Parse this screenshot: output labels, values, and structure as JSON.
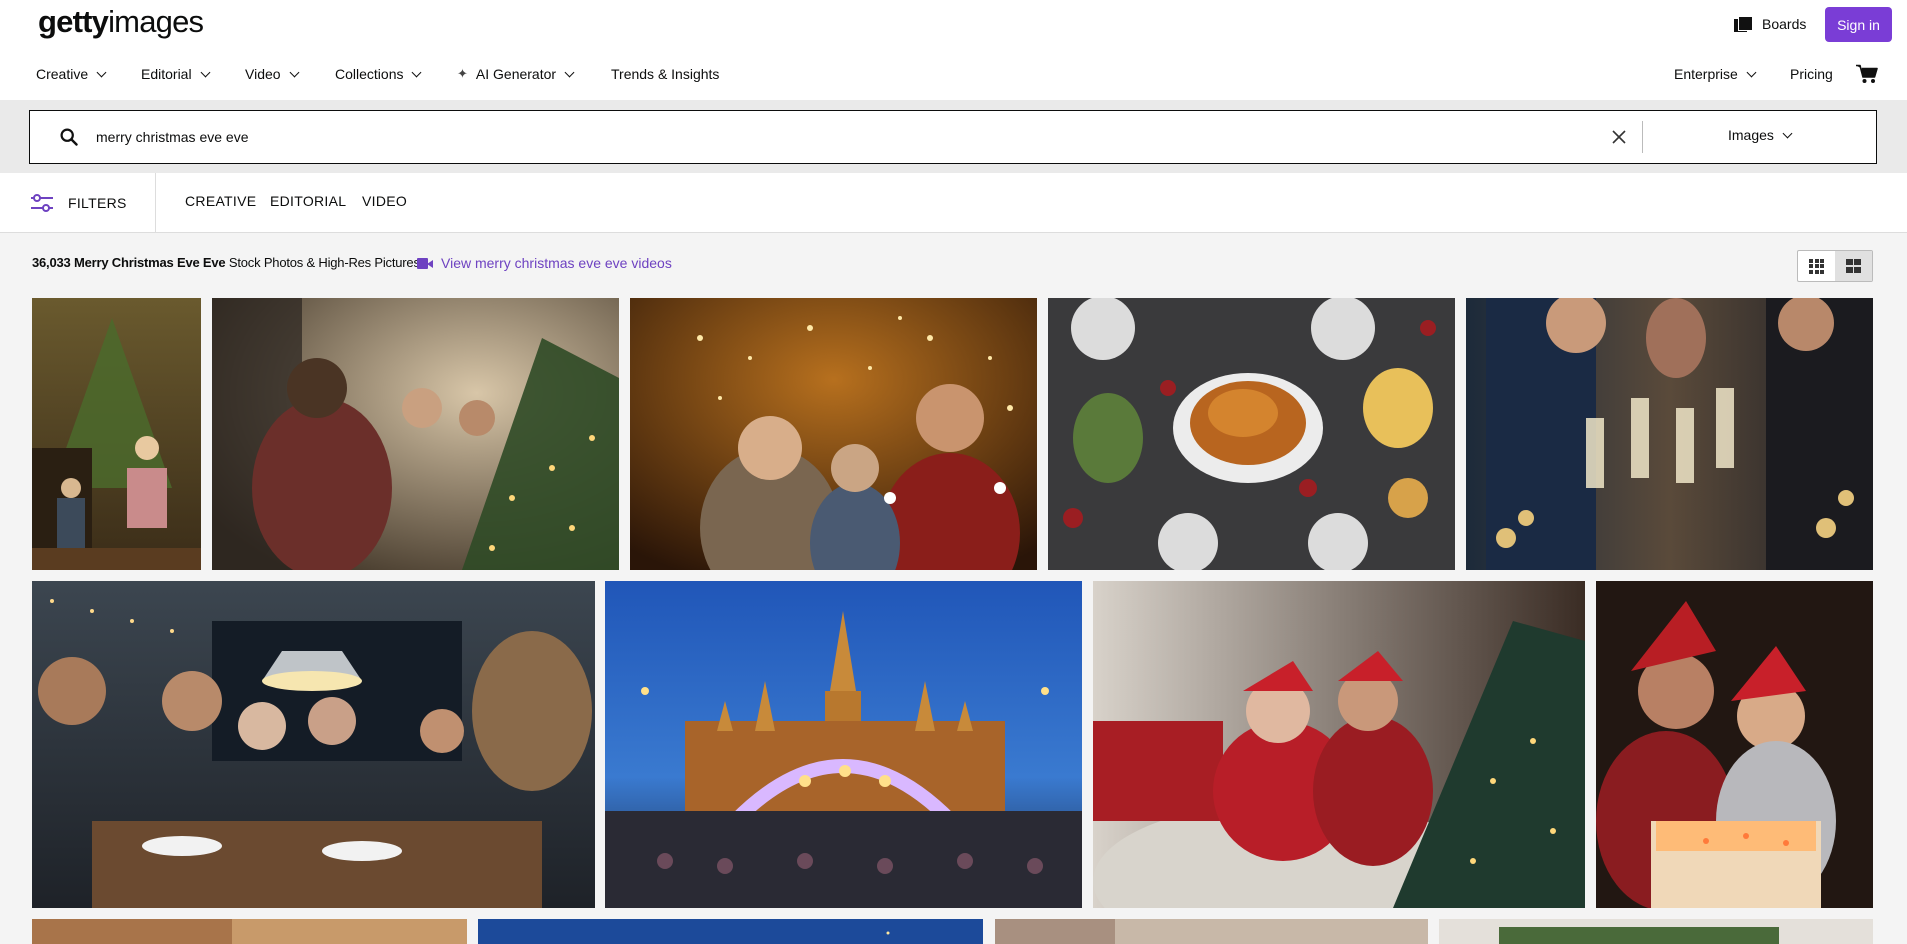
{
  "header": {
    "logo_bold": "getty",
    "logo_light": "images",
    "boards_label": "Boards",
    "signin_label": "Sign in",
    "accent_color": "#7a3dd6"
  },
  "nav": {
    "items": [
      {
        "label": "Creative"
      },
      {
        "label": "Editorial"
      },
      {
        "label": "Video"
      },
      {
        "label": "Collections"
      },
      {
        "label": "AI Generator"
      },
      {
        "label": "Trends & Insights"
      }
    ],
    "enterprise_label": "Enterprise",
    "pricing_label": "Pricing",
    "cart_icon": "cart-icon"
  },
  "search": {
    "query": "merry christmas eve eve",
    "media_type": "Images",
    "search_icon": "search-icon",
    "clear_icon": "close-icon"
  },
  "filters": {
    "button_label": "FILTERS",
    "tabs": [
      {
        "label": "CREATIVE"
      },
      {
        "label": "EDITORIAL"
      },
      {
        "label": "VIDEO"
      }
    ]
  },
  "results": {
    "count_bold": "36,033 Merry Christmas Eve Eve",
    "count_rest": "Stock Photos & High-Res Pictures",
    "video_link": "View merry christmas eve eve videos",
    "link_color": "#6e42c1"
  }
}
